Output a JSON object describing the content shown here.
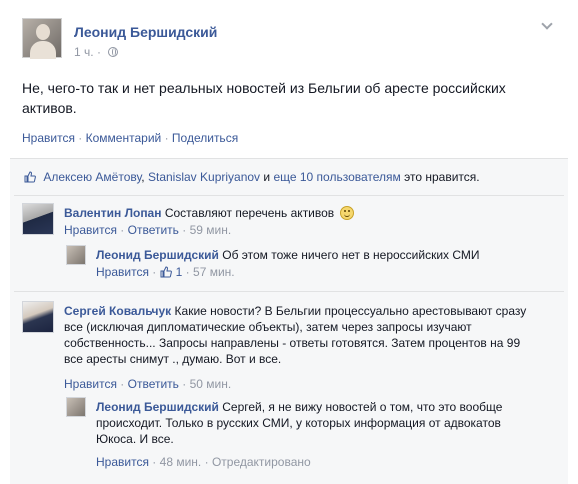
{
  "post": {
    "author": "Леонид Бершидский",
    "time": "1 ч.",
    "text": "Не, чего-то так и нет реальных новостей из Бельгии об аресте российских активов.",
    "actions": {
      "like": "Нравится",
      "comment": "Комментарий",
      "share": "Поделиться",
      "separator": "·"
    },
    "icons": {
      "privacy": "globe-icon",
      "menu": "chevron-down-icon"
    }
  },
  "likes": {
    "user1": "Алексею Амётову",
    "comma": ",",
    "user2": "Stanislav Kupriyanov",
    "and": "и",
    "others": "еще 10 пользователям",
    "suffix": "это нравится."
  },
  "comments": [
    {
      "author": "Валентин Лопан",
      "text": "Составляют перечень активов",
      "like": "Нравится",
      "reply": "Ответить",
      "time": "59 мин."
    },
    {
      "author": "Леонид Бершидский",
      "text": "Об этом тоже ничего нет в нероссийских СМИ",
      "like": "Нравится",
      "like_count": "1",
      "time": "57 мин."
    },
    {
      "author": "Сергей Ковальчук",
      "text": "Какие новости? В Бельгии процессуально арестовывают сразу все (исключая дипломатические объекты), затем через запросы изучают собственность... Запросы направлены - ответы готовятся. Затем процентов на 99 все аресты снимут ., думаю. Вот и все.",
      "like": "Нравится",
      "reply": "Ответить",
      "time": "50 мин."
    },
    {
      "author": "Леонид Бершидский",
      "text": "Сергей, я не вижу новостей о том, что это вообще происходит. Только в русских СМИ, у которых информация от адвокатов Юкоса. И все.",
      "like": "Нравится",
      "time": "48 мин.",
      "edited": "Отредактировано"
    }
  ],
  "colors": {
    "link": "#3b5998",
    "muted": "#9197a3",
    "text": "#141823",
    "panel": "#f6f7f8",
    "border": "#e1e2e3"
  }
}
